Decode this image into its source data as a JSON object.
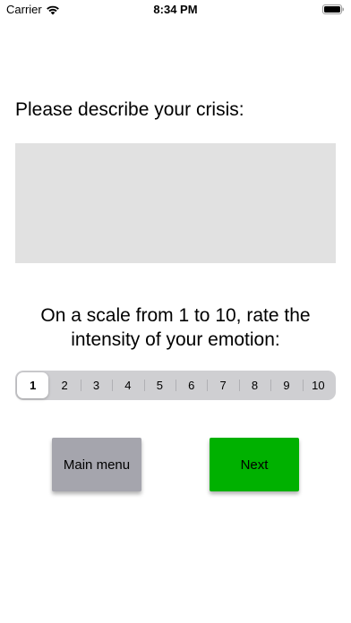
{
  "status_bar": {
    "carrier": "Carrier",
    "time": "8:34 PM",
    "icons": [
      "wifi-icon",
      "battery-icon"
    ]
  },
  "prompt": "Please describe your crisis:",
  "crisis_input": {
    "value": "",
    "background": "#e1e1e1"
  },
  "scale": {
    "question_line1": "On a scale from 1 to 10, rate the",
    "question_line2": "intensity of your emotion:",
    "options": [
      "1",
      "2",
      "3",
      "4",
      "5",
      "6",
      "7",
      "8",
      "9",
      "10"
    ],
    "selected": "1"
  },
  "buttons": {
    "main_menu": "Main menu",
    "next": "Next"
  },
  "colors": {
    "main_menu_button": "#a5a5ad",
    "next_button": "#00b100"
  }
}
